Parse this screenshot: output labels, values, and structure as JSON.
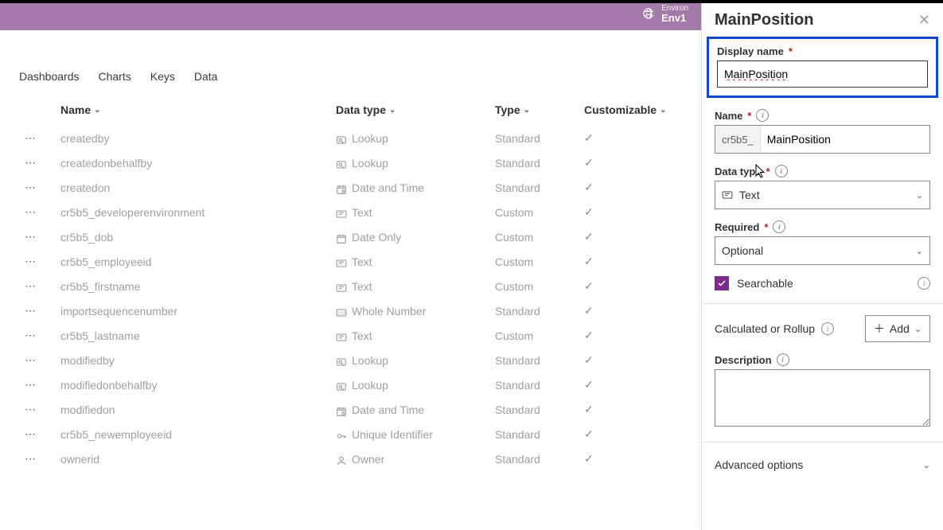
{
  "environment": {
    "label": "Environ",
    "name": "Env1"
  },
  "tabs": [
    "Dashboards",
    "Charts",
    "Keys",
    "Data"
  ],
  "columns": {
    "name": "Name",
    "datatype": "Data type",
    "type": "Type",
    "customizable": "Customizable"
  },
  "rows": [
    {
      "name": "createdby",
      "dtype": "Lookup",
      "type": "Standard",
      "icon": "lookup"
    },
    {
      "name": "createdonbehalfby",
      "dtype": "Lookup",
      "type": "Standard",
      "icon": "lookup"
    },
    {
      "name": "createdon",
      "dtype": "Date and Time",
      "type": "Standard",
      "icon": "datetime"
    },
    {
      "name": "cr5b5_developerenvironment",
      "dtype": "Text",
      "type": "Custom",
      "icon": "text"
    },
    {
      "name": "cr5b5_dob",
      "dtype": "Date Only",
      "type": "Custom",
      "icon": "date"
    },
    {
      "name": "cr5b5_employeeid",
      "dtype": "Text",
      "type": "Custom",
      "icon": "text"
    },
    {
      "name": "cr5b5_firstname",
      "dtype": "Text",
      "type": "Custom",
      "icon": "text"
    },
    {
      "name": "importsequencenumber",
      "dtype": "Whole Number",
      "type": "Standard",
      "icon": "number"
    },
    {
      "name": "cr5b5_lastname",
      "dtype": "Text",
      "type": "Custom",
      "icon": "text"
    },
    {
      "name": "modifiedby",
      "dtype": "Lookup",
      "type": "Standard",
      "icon": "lookup"
    },
    {
      "name": "modifiedonbehalfby",
      "dtype": "Lookup",
      "type": "Standard",
      "icon": "lookup"
    },
    {
      "name": "modifiedon",
      "dtype": "Date and Time",
      "type": "Standard",
      "icon": "datetime"
    },
    {
      "name": "cr5b5_newemployeeid",
      "dtype": "Unique Identifier",
      "type": "Standard",
      "icon": "key"
    },
    {
      "name": "ownerid",
      "dtype": "Owner",
      "type": "Standard",
      "icon": "owner"
    }
  ],
  "panel": {
    "title": "MainPosition",
    "display_name_label": "Display name",
    "display_name_value": "MainPosition",
    "name_label": "Name",
    "name_prefix": "cr5b5_",
    "name_value": "MainPosition",
    "datatype_label": "Data type",
    "datatype_value": "Text",
    "required_label": "Required",
    "required_value": "Optional",
    "searchable_label": "Searchable",
    "rollup_label": "Calculated or Rollup",
    "add_label": "Add",
    "description_label": "Description",
    "advanced_label": "Advanced options"
  }
}
